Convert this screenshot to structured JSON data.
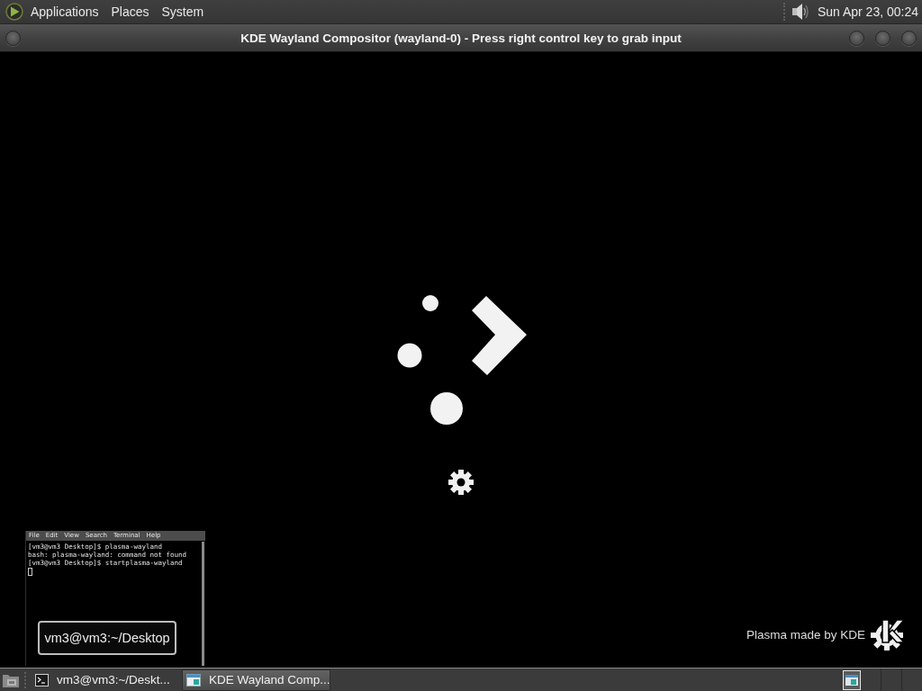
{
  "top_panel": {
    "menus": [
      "Applications",
      "Places",
      "System"
    ],
    "clock": "Sun Apr 23, 00:24"
  },
  "window": {
    "title": "KDE Wayland Compositor (wayland-0) - Press right control key to grab input"
  },
  "splash": {
    "credit": "Plasma made by KDE"
  },
  "terminal_preview": {
    "menu": [
      "File",
      "Edit",
      "View",
      "Search",
      "Terminal",
      "Help"
    ],
    "lines": [
      "[vm3@vm3 Desktop]$ plasma-wayland",
      "bash: plasma-wayland: command not found",
      "[vm3@vm3 Desktop]$ startplasma-wayland"
    ],
    "caption": "vm3@vm3:~/Desktop"
  },
  "taskbar": {
    "tasks": [
      {
        "kind": "terminal",
        "label": "vm3@vm3:~/Deskt...",
        "selected": false
      },
      {
        "kind": "window",
        "label": "KDE Wayland Comp...",
        "selected": true
      }
    ]
  }
}
